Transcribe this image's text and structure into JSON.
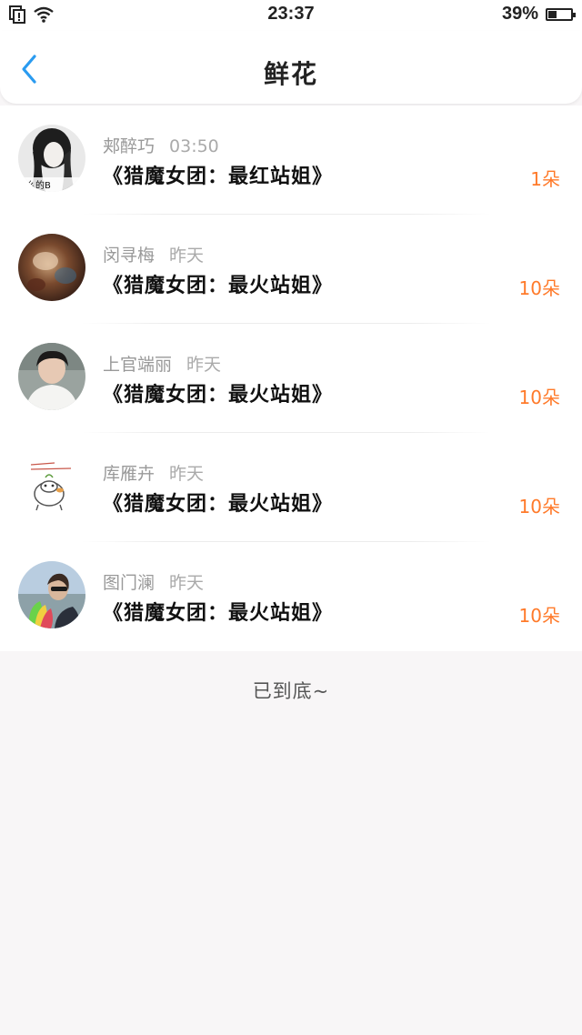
{
  "status_bar": {
    "time": "23:37",
    "battery_percent": "39%",
    "battery_level": 0.39
  },
  "header": {
    "title": "鲜花"
  },
  "gifts": [
    {
      "user": "郏醉巧",
      "time": "03:50",
      "title": "《猎魔女团：最红站姐》",
      "count": "1朵",
      "avatar_overlay_text": "么的B"
    },
    {
      "user": "闵寻梅",
      "time": "昨天",
      "title": "《猎魔女团：最火站姐》",
      "count": "10朵"
    },
    {
      "user": "上官端丽",
      "time": "昨天",
      "title": "《猎魔女团：最火站姐》",
      "count": "10朵"
    },
    {
      "user": "库雁卉",
      "time": "昨天",
      "title": "《猎魔女团：最火站姐》",
      "count": "10朵"
    },
    {
      "user": "图门澜",
      "time": "昨天",
      "title": "《猎魔女团：最火站姐》",
      "count": "10朵"
    }
  ],
  "footer": {
    "end_text": "已到底~"
  },
  "colors": {
    "accent_blue": "#2a9bf0",
    "count_orange": "#ff7a2a",
    "page_background": "#f8f6f7"
  }
}
